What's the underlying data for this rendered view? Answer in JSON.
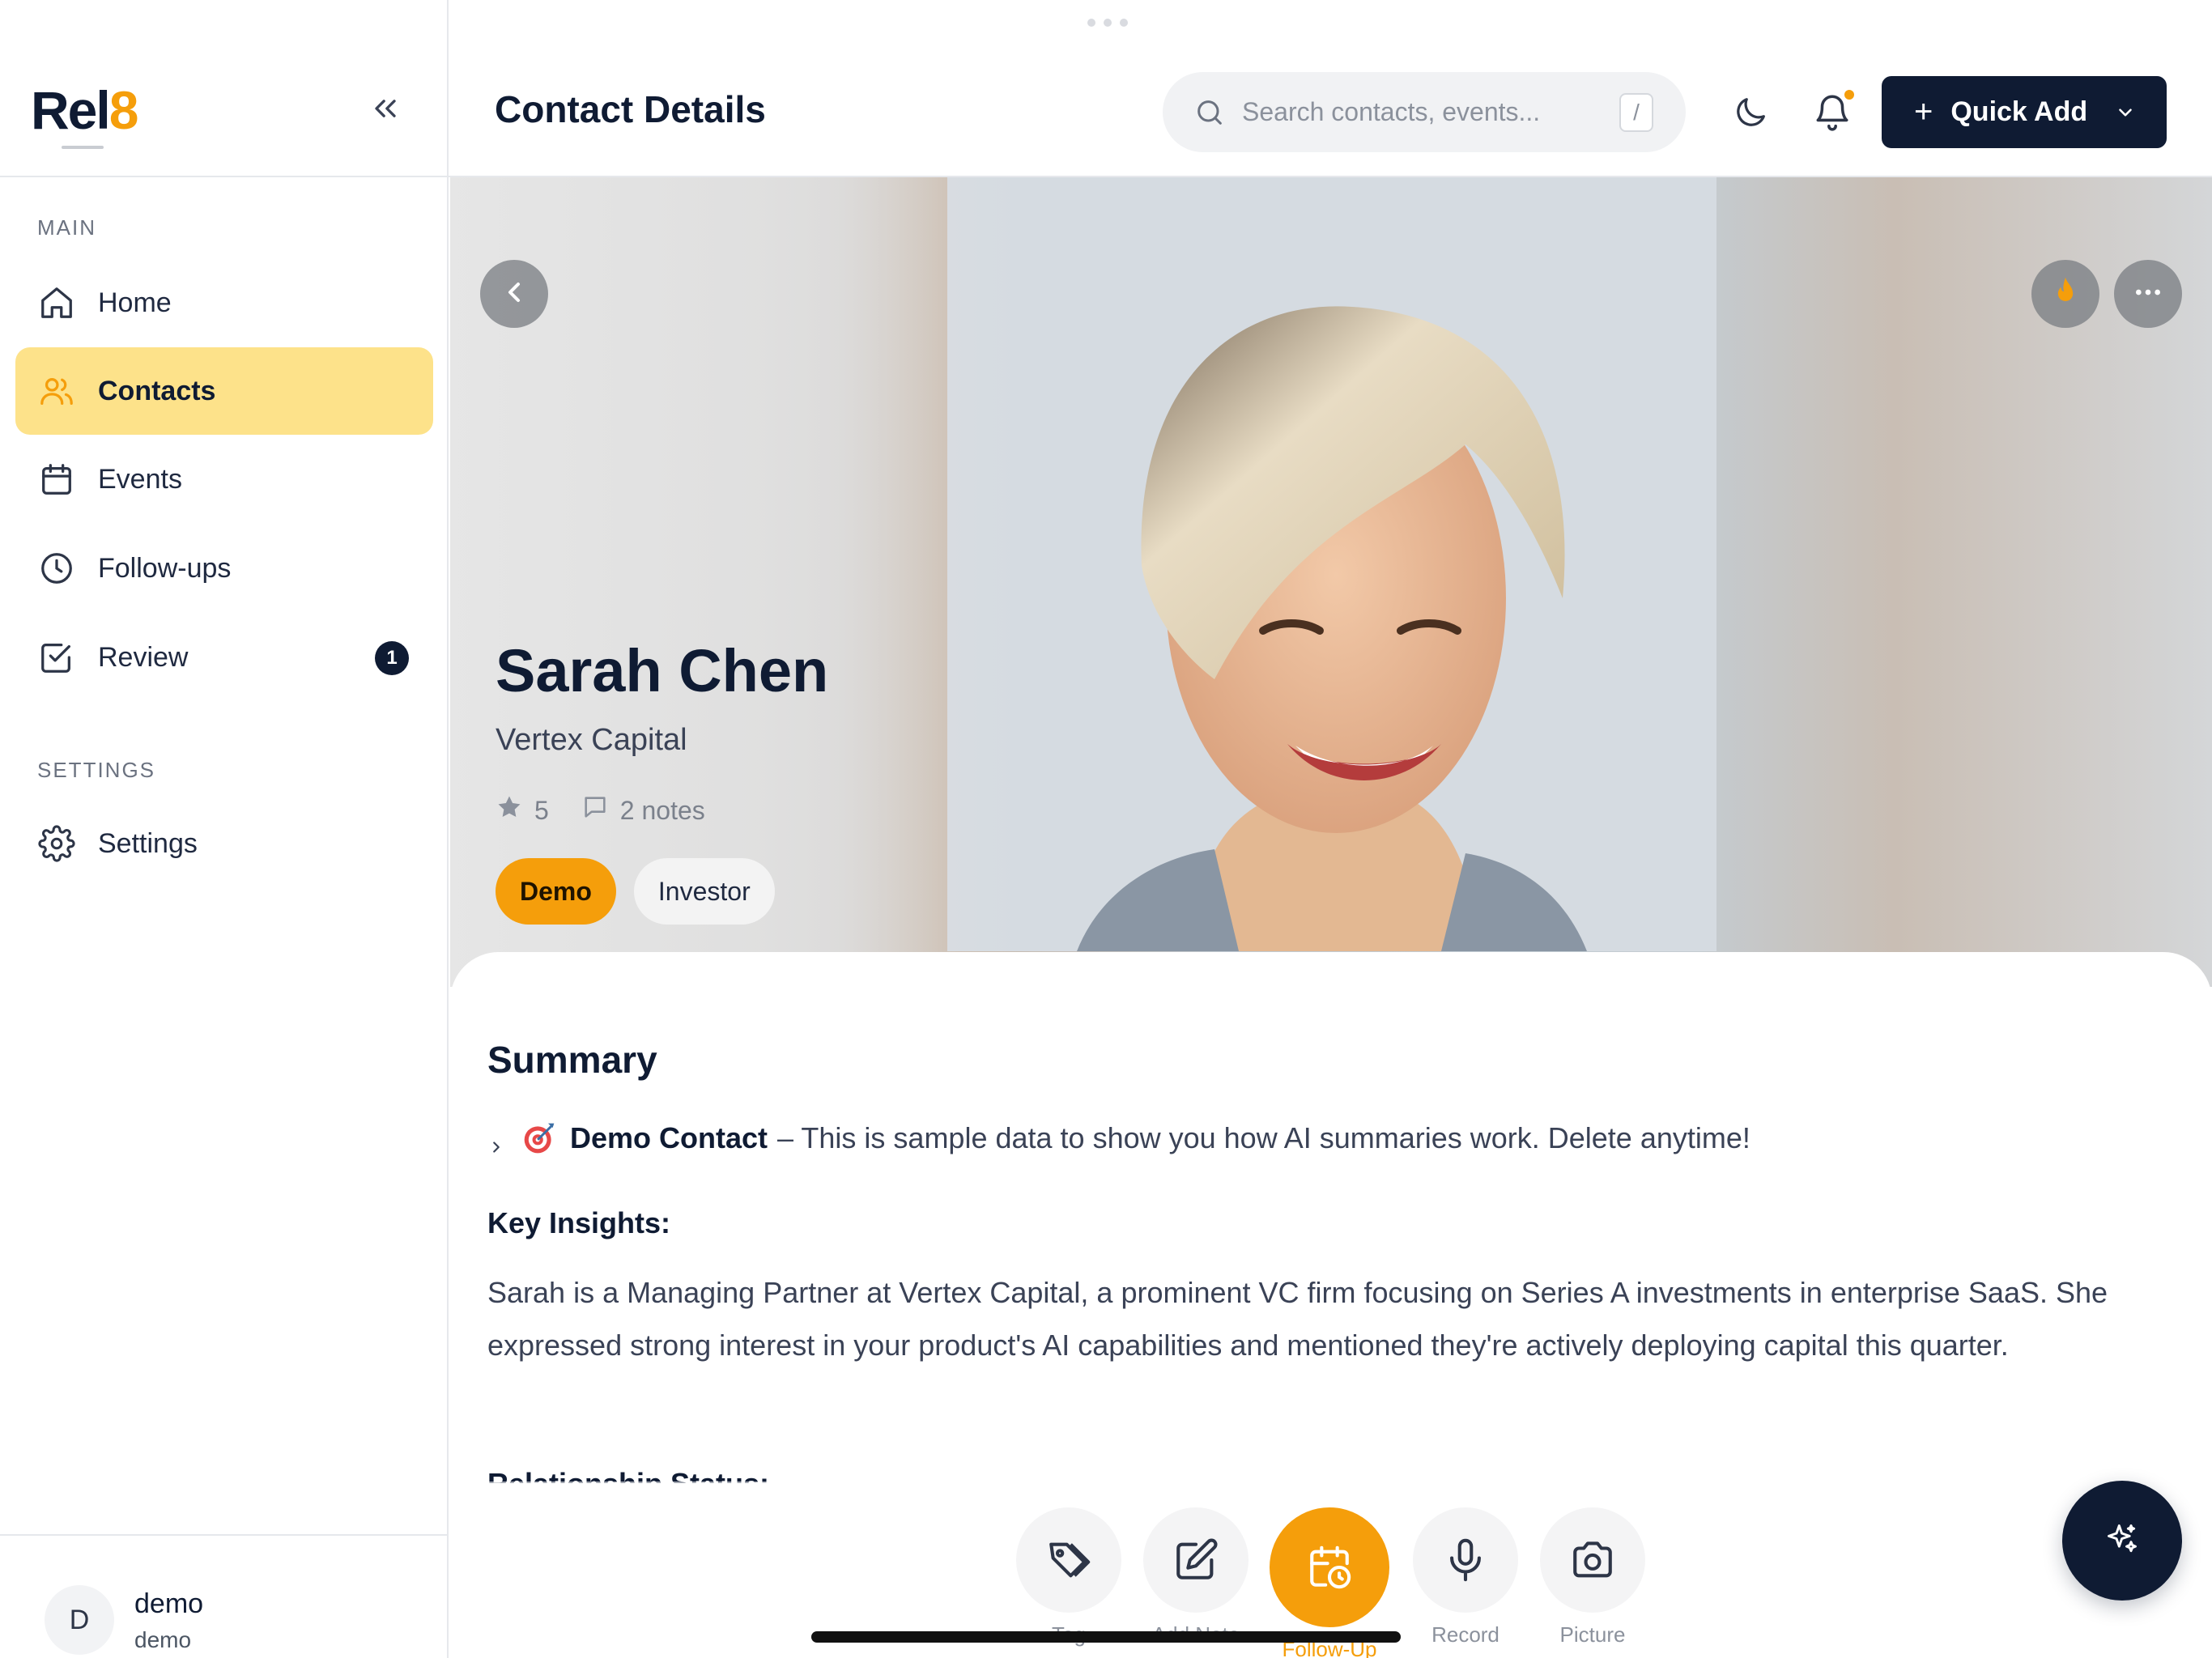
{
  "app": {
    "logo_text": "Rel",
    "logo_accent": "8"
  },
  "sidebar": {
    "main_label": "MAIN",
    "settings_label": "SETTINGS",
    "items": [
      {
        "label": "Home",
        "icon": "home-icon"
      },
      {
        "label": "Contacts",
        "icon": "users-icon",
        "active": true
      },
      {
        "label": "Events",
        "icon": "calendar-icon"
      },
      {
        "label": "Follow-ups",
        "icon": "clock-icon"
      },
      {
        "label": "Review",
        "icon": "check-square-icon",
        "badge": "1"
      }
    ],
    "settings_item": {
      "label": "Settings",
      "icon": "gear-icon"
    },
    "user": {
      "initial": "D",
      "name": "demo",
      "sub": "demo"
    }
  },
  "header": {
    "title": "Contact Details",
    "search_placeholder": "Search contacts, events...",
    "search_shortcut": "/",
    "quick_add_label": "Quick Add"
  },
  "contact": {
    "name": "Sarah Chen",
    "company": "Vertex Capital",
    "rating": "5",
    "notes": "2 notes",
    "tags": [
      "Demo",
      "Investor"
    ]
  },
  "summary": {
    "title": "Summary",
    "demo_label": "Demo Contact",
    "demo_text": "– This is sample data to show you how AI summaries work. Delete anytime!",
    "insights_title": "Key Insights:",
    "insights_text": "Sarah is a Managing Partner at Vertex Capital, a prominent VC firm focusing on Series A investments in enterprise SaaS. She expressed strong interest in your product's AI capabilities and mentioned they're actively deploying capital this quarter.",
    "relationship_title": "Relationship Status:"
  },
  "actions": [
    {
      "label": "Tag",
      "icon": "tag-icon"
    },
    {
      "label": "Add Note",
      "icon": "edit-icon"
    },
    {
      "label": "Follow-Up",
      "icon": "calendar-clock-icon"
    },
    {
      "label": "Record",
      "icon": "mic-icon"
    },
    {
      "label": "Picture",
      "icon": "camera-icon"
    }
  ],
  "colors": {
    "accent": "#f59e0b",
    "navy": "#0f1b33",
    "active_nav": "#fde28a"
  }
}
